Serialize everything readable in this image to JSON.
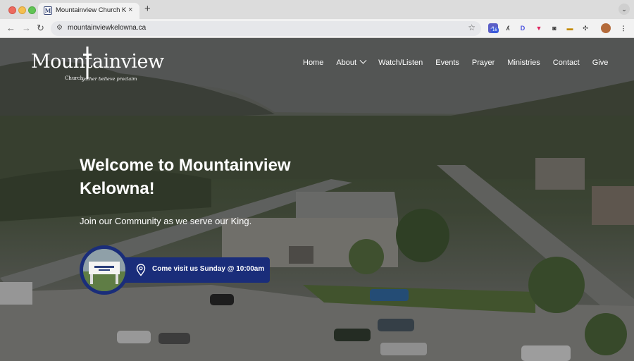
{
  "browser": {
    "tab_title": "Mountainview Church Kelowna",
    "tab_close": "×",
    "new_tab": "+",
    "url": "mountainviewkelowna.ca",
    "extension_badge": "16"
  },
  "site": {
    "logo_word": "Mountainview",
    "logo_church": "Church",
    "logo_tagline": "gather believe proclaim",
    "nav": [
      "Home",
      "About",
      "Watch/Listen",
      "Events",
      "Prayer",
      "Ministries",
      "Contact",
      "Give"
    ],
    "hero_title": "Welcome to Mountainview Kelowna!",
    "hero_subtitle": "Join our Community as we serve our King.",
    "cta_label": "Come visit us Sunday @ 10:00am"
  },
  "colors": {
    "cta_blue": "#1a2d7a",
    "overlay": "rgba(20,20,20,0.38)"
  }
}
